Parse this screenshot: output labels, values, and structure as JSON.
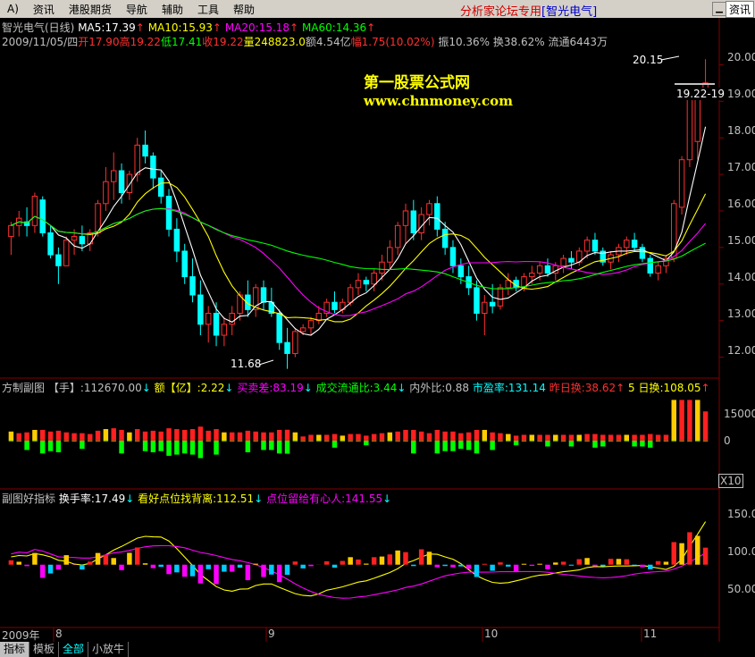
{
  "menu": {
    "items": [
      "资讯",
      "港股期货",
      "导航",
      "辅助",
      "工具",
      "帮助"
    ],
    "banner_prefix": "分析家论坛专用",
    "banner_stock": "[智光电气]",
    "search_label": "资讯",
    "left_stub": "A)"
  },
  "main": {
    "title": "智光电气(日线)",
    "ma5_label": "MA5:17.39",
    "ma10_label": "MA10:15.93",
    "ma20_label": "MA20:15.18",
    "ma60_label": "MA60:14.36",
    "date": "2009/11/05/四",
    "open_label": "开17.90",
    "high_label": "高19.22",
    "low_label": "低17.41",
    "close_label": "收19.22",
    "vol_label": "量248823.0",
    "amount_label": "额4.54亿",
    "change_label": "幅1.75(10.02%)",
    "amp_label": "振10.36%",
    "turnover_label": "换38.62%",
    "float_label": "流通6443万",
    "watermark_cn": "第一股票公式网",
    "watermark_url": "www.chnmoney.com",
    "high_marker": "20.15",
    "low_marker": "11.68",
    "price_tag": "19.22-19",
    "price_axis": [
      "20.00",
      "19.00",
      "18.00",
      "17.00",
      "16.00",
      "15.00",
      "14.00",
      "13.00",
      "12.00"
    ]
  },
  "vol_panel": {
    "title": "方制副图 【手】:112670.00",
    "amount": "额【亿】:2.22",
    "buysell": "买卖差:83.19",
    "float_ratio": "成交流通比:3.44",
    "inout": "内外比:0.88",
    "pe": "市盈率:131.14",
    "prev_turn": "昨日换:38.62",
    "turn5": "5 日换:108.05",
    "axis": [
      "15000",
      "0"
    ],
    "x10": "X10"
  },
  "ind_panel": {
    "title": "副图好指标",
    "turnover": "换手率:17.49",
    "watch": "看好点位找背离:112.51",
    "note": "点位留给有心人:141.55",
    "axis": [
      "150.00",
      "100.00",
      "50.00"
    ]
  },
  "xaxis": {
    "labels": [
      "2009年",
      "8",
      "9",
      "10",
      "11"
    ]
  },
  "tabs": [
    "指标",
    "模板",
    "全部",
    "小放牛"
  ],
  "chart_data": {
    "type": "candlestick",
    "candles": [
      [
        15.3,
        15.7,
        14.8,
        15.6
      ],
      [
        15.6,
        16.0,
        15.3,
        15.8
      ],
      [
        15.7,
        16.1,
        15.3,
        15.6
      ],
      [
        15.6,
        16.5,
        15.4,
        16.4
      ],
      [
        16.3,
        16.4,
        15.3,
        15.4
      ],
      [
        15.4,
        15.6,
        14.7,
        14.8
      ],
      [
        14.8,
        15.0,
        14.0,
        14.5
      ],
      [
        14.5,
        15.3,
        14.5,
        15.2
      ],
      [
        15.2,
        15.5,
        14.8,
        15.3
      ],
      [
        15.3,
        15.6,
        14.9,
        15.1
      ],
      [
        15.1,
        15.5,
        14.9,
        15.4
      ],
      [
        15.4,
        16.3,
        15.3,
        16.2
      ],
      [
        16.2,
        17.2,
        16.0,
        16.8
      ],
      [
        16.8,
        17.6,
        16.3,
        17.1
      ],
      [
        17.1,
        17.3,
        16.2,
        16.5
      ],
      [
        16.5,
        17.1,
        16.3,
        17.0
      ],
      [
        17.0,
        18.0,
        16.8,
        17.8
      ],
      [
        17.8,
        18.2,
        17.3,
        17.5
      ],
      [
        17.5,
        17.6,
        16.6,
        16.9
      ],
      [
        16.9,
        17.1,
        16.2,
        16.4
      ],
      [
        16.4,
        16.6,
        15.3,
        15.5
      ],
      [
        15.5,
        15.8,
        14.6,
        14.9
      ],
      [
        14.9,
        15.1,
        14.0,
        14.2
      ],
      [
        14.2,
        14.7,
        13.5,
        13.7
      ],
      [
        13.7,
        14.1,
        12.6,
        12.9
      ],
      [
        12.9,
        13.4,
        12.4,
        13.2
      ],
      [
        13.2,
        13.5,
        12.3,
        12.6
      ],
      [
        12.6,
        13.1,
        12.3,
        12.9
      ],
      [
        12.9,
        13.4,
        12.6,
        13.2
      ],
      [
        13.2,
        13.8,
        13.0,
        13.7
      ],
      [
        13.7,
        14.1,
        13.1,
        13.3
      ],
      [
        13.3,
        14.0,
        13.1,
        13.9
      ],
      [
        13.9,
        14.1,
        13.3,
        13.5
      ],
      [
        13.5,
        13.9,
        13.1,
        13.2
      ],
      [
        13.2,
        13.3,
        12.2,
        12.4
      ],
      [
        12.4,
        12.8,
        11.68,
        12.1
      ],
      [
        12.1,
        12.8,
        12.0,
        12.7
      ],
      [
        12.7,
        12.9,
        12.6,
        12.8
      ],
      [
        12.8,
        13.1,
        12.6,
        13.0
      ],
      [
        13.0,
        13.4,
        12.9,
        13.2
      ],
      [
        13.2,
        13.6,
        13.1,
        13.5
      ],
      [
        13.5,
        13.8,
        13.2,
        13.3
      ],
      [
        13.3,
        13.6,
        13.2,
        13.5
      ],
      [
        13.5,
        14.0,
        13.4,
        13.9
      ],
      [
        13.9,
        14.3,
        13.7,
        14.1
      ],
      [
        14.1,
        14.2,
        13.8,
        14.0
      ],
      [
        14.0,
        14.4,
        13.8,
        14.3
      ],
      [
        14.3,
        14.8,
        14.1,
        14.6
      ],
      [
        14.6,
        15.2,
        14.4,
        15.0
      ],
      [
        15.0,
        15.7,
        14.8,
        15.6
      ],
      [
        15.6,
        16.2,
        15.1,
        16.0
      ],
      [
        16.0,
        16.3,
        15.2,
        15.4
      ],
      [
        15.4,
        16.1,
        15.2,
        15.9
      ],
      [
        15.9,
        16.3,
        15.6,
        16.2
      ],
      [
        16.2,
        16.4,
        15.3,
        15.5
      ],
      [
        15.5,
        15.7,
        14.8,
        15.0
      ],
      [
        15.0,
        15.2,
        14.3,
        14.5
      ],
      [
        14.5,
        14.7,
        14.0,
        14.2
      ],
      [
        14.2,
        14.5,
        13.7,
        13.9
      ],
      [
        13.9,
        14.1,
        13.0,
        13.2
      ],
      [
        13.2,
        13.7,
        12.6,
        13.5
      ],
      [
        13.5,
        14.0,
        13.2,
        13.4
      ],
      [
        13.4,
        14.0,
        13.3,
        13.9
      ],
      [
        13.9,
        14.3,
        13.7,
        14.1
      ],
      [
        14.1,
        14.2,
        13.8,
        13.9
      ],
      [
        13.9,
        14.3,
        13.8,
        14.2
      ],
      [
        14.2,
        14.5,
        14.0,
        14.3
      ],
      [
        14.3,
        14.6,
        14.1,
        14.5
      ],
      [
        14.5,
        14.7,
        14.2,
        14.3
      ],
      [
        14.3,
        14.6,
        14.1,
        14.5
      ],
      [
        14.5,
        14.8,
        14.3,
        14.7
      ],
      [
        14.7,
        14.9,
        14.4,
        14.6
      ],
      [
        14.6,
        15.0,
        14.5,
        14.9
      ],
      [
        14.9,
        15.3,
        14.7,
        15.2
      ],
      [
        15.2,
        15.4,
        14.8,
        14.9
      ],
      [
        14.9,
        15.0,
        14.5,
        14.6
      ],
      [
        14.6,
        14.9,
        14.4,
        14.8
      ],
      [
        14.8,
        15.1,
        14.6,
        15.0
      ],
      [
        15.0,
        15.3,
        14.8,
        15.2
      ],
      [
        15.2,
        15.4,
        14.9,
        15.0
      ],
      [
        15.0,
        15.1,
        14.6,
        14.7
      ],
      [
        14.7,
        14.8,
        14.2,
        14.3
      ],
      [
        14.3,
        14.6,
        14.1,
        14.5
      ],
      [
        14.5,
        14.8,
        14.3,
        14.7
      ],
      [
        14.7,
        16.3,
        14.6,
        16.2
      ],
      [
        16.1,
        17.5,
        15.9,
        17.4
      ],
      [
        17.4,
        19.2,
        17.2,
        19.2
      ],
      [
        17.9,
        19.22,
        17.41,
        19.22
      ],
      [
        19.22,
        20.15,
        19.1,
        19.5
      ]
    ],
    "ylim": [
      11.5,
      20.4
    ],
    "vol_ylim": [
      -15000,
      22000
    ],
    "ind_ylim": [
      25,
      170
    ]
  }
}
